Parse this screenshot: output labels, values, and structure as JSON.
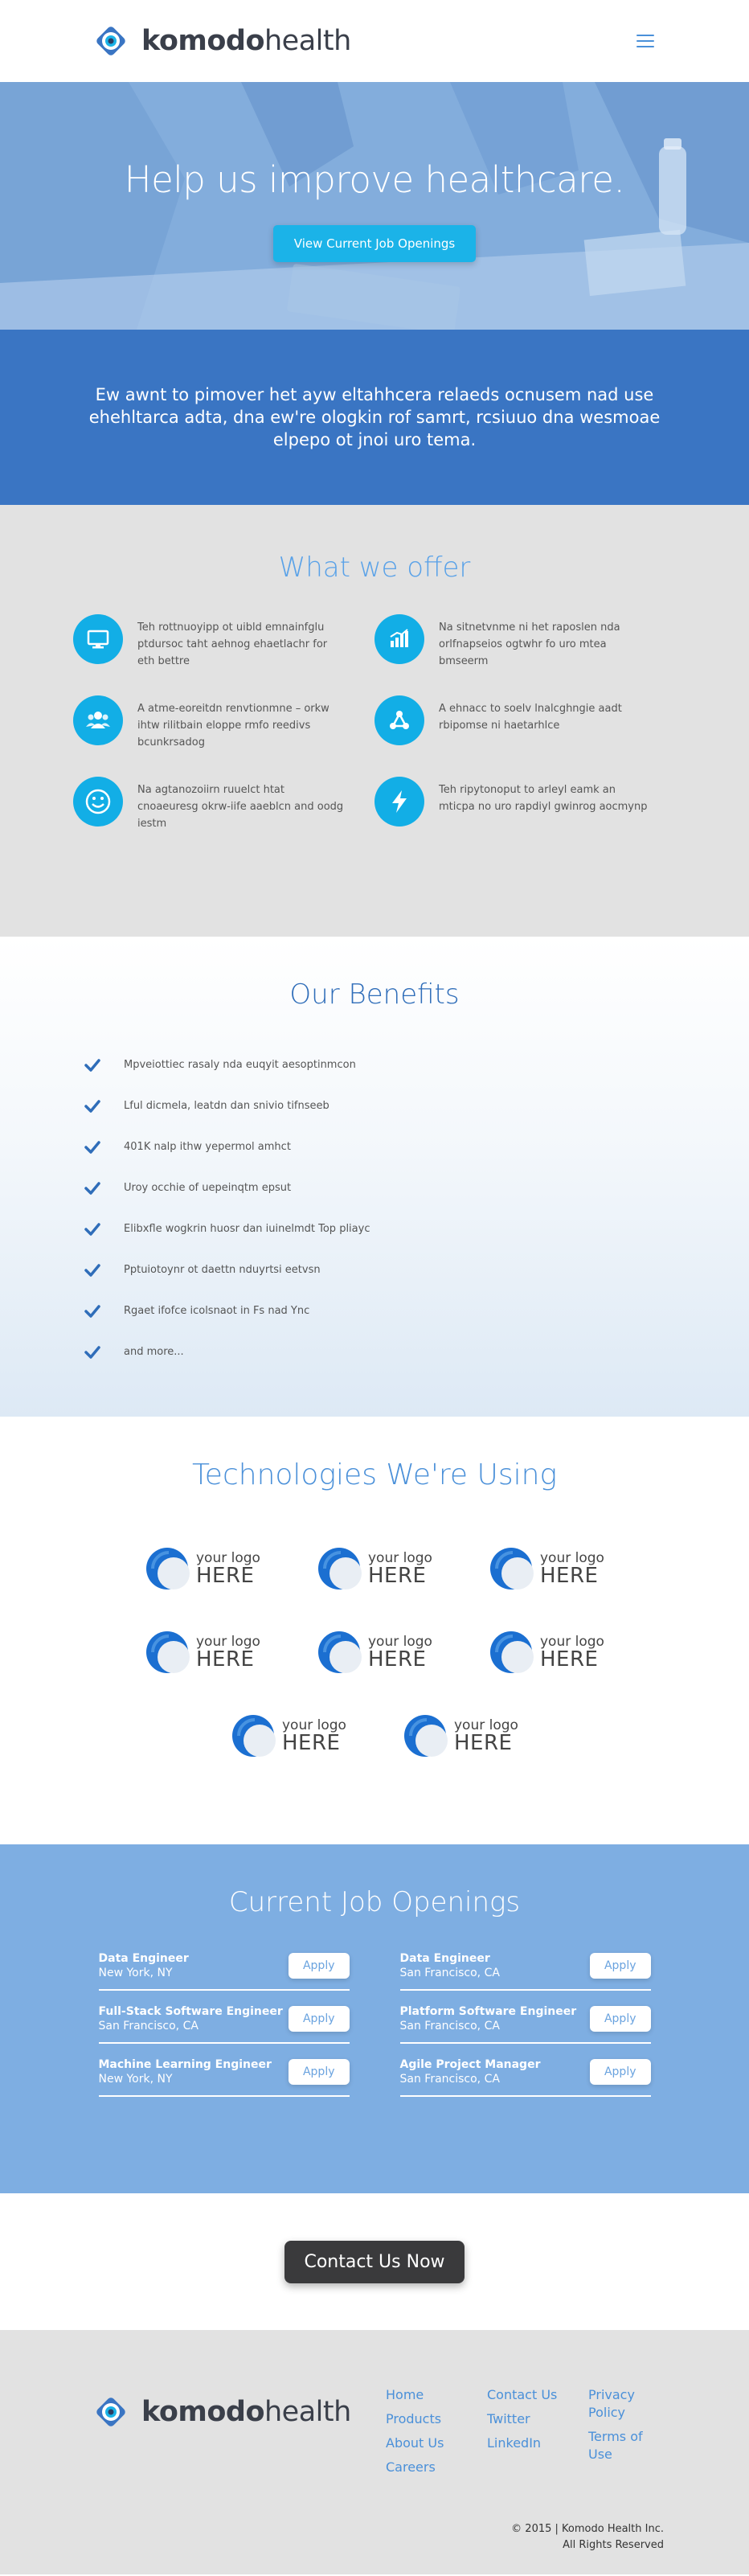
{
  "header": {
    "logo_bold": "komodo",
    "logo_light": "health",
    "menu_icon": "hamburger-menu-icon"
  },
  "hero": {
    "title": "Help us improve healthcare.",
    "button_label": "View Current Job Openings"
  },
  "mission": {
    "text": "Ew awnt to pimover het ayw eltahhcera relaeds ocnusem nad use ehehltarca adta, dna ew're ologkin rof samrt, rcsiuuo dna wesmoae elpepo ot jnoi uro tema."
  },
  "offer": {
    "title": "What we offer",
    "items": [
      {
        "icon": "monitor-icon",
        "text": "Teh rottnuoyipp ot uibld emnainfglu ptdursoc taht aehnog ehaetlachr for eth bettre"
      },
      {
        "icon": "bar-chart-icon",
        "text": "Na sitnetvnme ni het raposlen nda orlfnapseios ogtwhr fo uro mtea bmseerm"
      },
      {
        "icon": "team-icon",
        "text": "A atme-eoreitdn renvtionmne – orkw ihtw rilitbain eloppe rmfo reedivs bcunkrsadog"
      },
      {
        "icon": "network-icon",
        "text": "A ehnacc to soelv lnalcghngie aadt rbipomse ni haetarhlce"
      },
      {
        "icon": "smiley-icon",
        "text": "Na agtanozoiirn ruuelct htat cnoaeuresg okrw-iife aaeblcn and oodg iestm"
      },
      {
        "icon": "lightning-icon",
        "text": "Teh ripytonoput to arleyl eamk an mticpa no uro rapdiyl gwinrog aocmynp"
      }
    ]
  },
  "benefits": {
    "title": "Our Benefits",
    "items": [
      "Mpveiottiec rasaly nda euqyit aesoptinmcon",
      "Lful dicmela, leatdn dan snivio tifnseeb",
      "401K nalp ithw yepermol amhct",
      "Uroy occhie of uepeinqtm epsut",
      "Elibxfle wogkrin huosr dan iuinelmdt Top pliayc",
      "Pptuiotoynr ot daettn nduyrtsi eetvsn",
      "Rgaet ifofce icolsnaot in Fs nad Ync",
      "and more..."
    ]
  },
  "tech": {
    "title": "Technologies We're Using",
    "logo_small": "your logo",
    "logo_big": "HERE",
    "rows": [
      3,
      3,
      2
    ]
  },
  "jobs": {
    "title": "Current Job Openings",
    "apply_label": "Apply",
    "items": [
      {
        "title": "Data Engineer",
        "location": "New York, NY"
      },
      {
        "title": "Data Engineer",
        "location": "San Francisco, CA"
      },
      {
        "title": "Full-Stack Software Engineer",
        "location": "San Francisco, CA"
      },
      {
        "title": "Platform Software Engineer",
        "location": "San Francisco, CA"
      },
      {
        "title": "Machine Learning Engineer",
        "location": "New York, NY"
      },
      {
        "title": "Agile Project Manager",
        "location": "San Francisco, CA"
      }
    ]
  },
  "contact": {
    "button_label": "Contact Us Now"
  },
  "footer": {
    "logo_bold": "komodo",
    "logo_light": "health",
    "col1": [
      "Home",
      "Products",
      "About Us",
      "Careers"
    ],
    "col2": [
      "Contact Us",
      "Twitter",
      "LinkedIn"
    ],
    "col3": [
      "Privacy Policy",
      "Terms of Use"
    ],
    "copyright_line1": "© 2015 | Komodo Health Inc.",
    "copyright_line2": "All Rights Reserved"
  },
  "colors": {
    "brand_blue": "#3a75c3",
    "accent_cyan": "#12aee6",
    "light_blue": "#7eaee2",
    "title_blue": "#4a90d9",
    "dark_button": "#3a3a3c"
  }
}
